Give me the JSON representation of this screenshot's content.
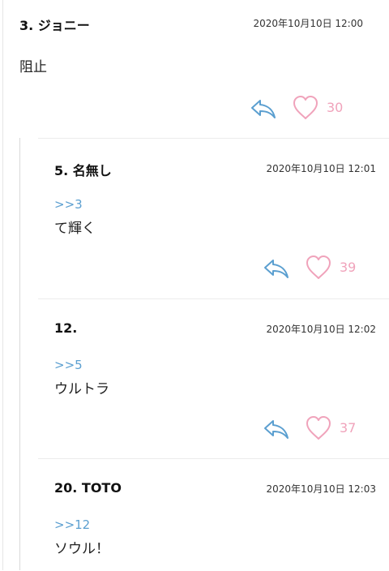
{
  "thread": {
    "post": {
      "number_name": "3.  ジョニー",
      "date": "2020年10月10日 12:00",
      "body": "阻止",
      "likes": "30",
      "reply_icon": "reply-arrow-icon",
      "like_icon": "heart-icon"
    },
    "replies": [
      {
        "number_name": "5.  名無し",
        "date": "2020年10月10日 12:01",
        "anchor": ">>3",
        "body": "て輝く",
        "likes": "39"
      },
      {
        "number_name": "12.",
        "date": "2020年10月10日 12:02",
        "anchor": ">>5",
        "body": "ウルトラ",
        "likes": "37"
      },
      {
        "number_name": "20.  TOTO",
        "date": "2020年10月10日 12:03",
        "anchor": ">>12",
        "body": "ソウル！"
      }
    ]
  },
  "colors": {
    "link_blue": "#5b9fd0",
    "heart_pink": "#f0a3bb",
    "divider": "#ececec"
  }
}
